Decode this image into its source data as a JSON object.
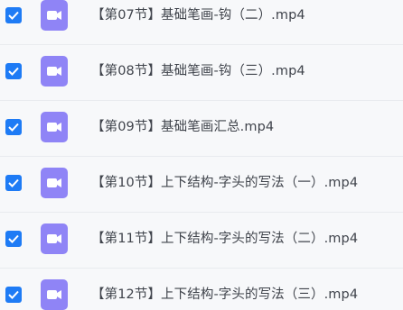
{
  "colors": {
    "checkbox": "#1e7bf5",
    "file_icon": "#8f84f6",
    "text": "#3f434b",
    "background": "#f7f8fa"
  },
  "icons": {
    "checkbox": "checkmark-icon",
    "file": "video-file-icon"
  },
  "files": [
    {
      "name": "【第07节】基础笔画-钩（二）.mp4",
      "checked": true
    },
    {
      "name": "【第08节】基础笔画-钩（三）.mp4",
      "checked": true
    },
    {
      "name": "【第09节】基础笔画汇总.mp4",
      "checked": true
    },
    {
      "name": "【第10节】上下结构-字头的写法（一）.mp4",
      "checked": true
    },
    {
      "name": "【第11节】上下结构-字头的写法（二）.mp4",
      "checked": true
    },
    {
      "name": "【第12节】上下结构-字头的写法（三）.mp4",
      "checked": true
    }
  ]
}
